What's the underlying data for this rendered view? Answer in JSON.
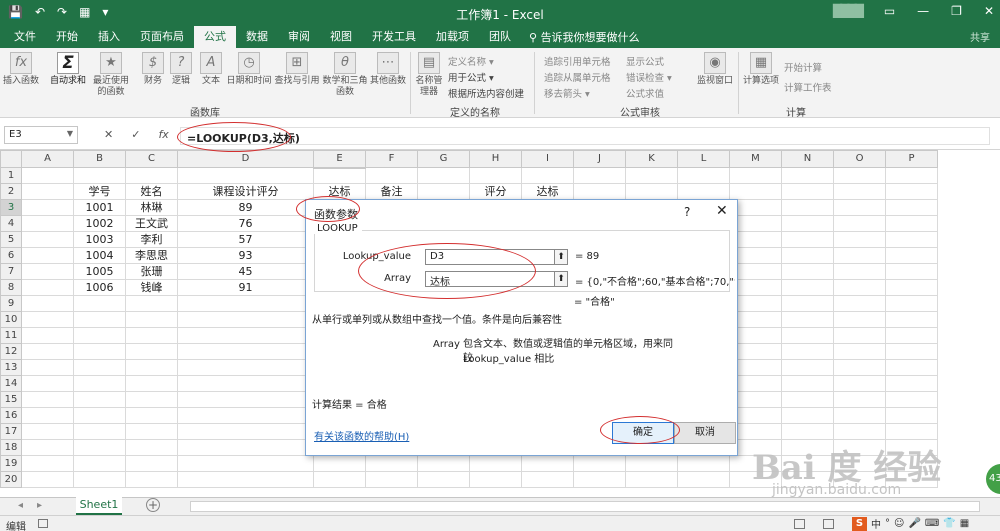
{
  "window": {
    "title": "工作簿1 - Excel",
    "qat": [
      "💾",
      "↶",
      "↷",
      "▦",
      "▾"
    ],
    "controls": [
      "▭",
      "—",
      "❐",
      "✕"
    ],
    "account": "████"
  },
  "tabs": [
    "文件",
    "开始",
    "插入",
    "页面布局",
    "公式",
    "数据",
    "审阅",
    "视图",
    "开发工具",
    "加载项",
    "团队"
  ],
  "tell_me": "告诉我你想要做什么",
  "share": "共享",
  "ribbon": {
    "groups": {
      "function_library": "函数库",
      "defined_names": "定义的名称",
      "formula_auditing": "公式审核",
      "calculation": "计算"
    },
    "buttons": [
      {
        "label": "插入函数",
        "icon": "fx"
      },
      {
        "label": "自动求和",
        "icon": "Σ"
      },
      {
        "label": "最近使用的函数",
        "icon": "★"
      },
      {
        "label": "财务",
        "icon": "$"
      },
      {
        "label": "逻辑",
        "icon": "?"
      },
      {
        "label": "文本",
        "icon": "A"
      },
      {
        "label": "日期和时间",
        "icon": "◷"
      },
      {
        "label": "查找与引用",
        "icon": "⊞"
      },
      {
        "label": "数学和三角函数",
        "icon": "θ"
      },
      {
        "label": "其他函数",
        "icon": "⋯"
      },
      {
        "label": "名称管理器",
        "icon": "▤"
      },
      {
        "label": "监视窗口",
        "icon": "◉"
      },
      {
        "label": "计算选项",
        "icon": "▦"
      }
    ],
    "defined_names": [
      "定义名称 ▾",
      "用于公式 ▾",
      "根据所选内容创建"
    ],
    "auditing_left": [
      "追踪引用单元格",
      "追踪从属单元格",
      "移去箭头 ▾"
    ],
    "auditing_right": [
      "显示公式",
      "错误检查 ▾",
      "公式求值"
    ],
    "calc": [
      "开始计算",
      "计算工作表"
    ]
  },
  "formula_bar": {
    "name_box": "E3",
    "cancel": "✕",
    "enter": "✓",
    "fx": "fx",
    "formula": "=LOOKUP(D3,达标)"
  },
  "columns": [
    "A",
    "B",
    "C",
    "D",
    "E",
    "F",
    "G",
    "H",
    "I",
    "J",
    "K",
    "L",
    "M",
    "N",
    "O",
    "P"
  ],
  "rows": [
    [
      "",
      "",
      "",
      "",
      "",
      "",
      "",
      "",
      "",
      "",
      "",
      "",
      "",
      "",
      "",
      ""
    ],
    [
      "",
      "学号",
      "姓名",
      "课程设计评分",
      "达标",
      "备注",
      "",
      "评分",
      "达标",
      "",
      "",
      "",
      "",
      "",
      "",
      ""
    ],
    [
      "",
      "1001",
      "林琳",
      "89",
      "",
      "",
      "",
      "",
      "",
      "",
      "",
      "",
      "",
      "",
      "",
      ""
    ],
    [
      "",
      "1002",
      "王文武",
      "76",
      "",
      "",
      "",
      "",
      "",
      "",
      "",
      "",
      "",
      "",
      "",
      ""
    ],
    [
      "",
      "1003",
      "李利",
      "57",
      "",
      "",
      "",
      "",
      "",
      "",
      "",
      "",
      "",
      "",
      "",
      ""
    ],
    [
      "",
      "1004",
      "李思思",
      "93",
      "",
      "",
      "",
      "",
      "",
      "",
      "",
      "",
      "",
      "",
      "",
      ""
    ],
    [
      "",
      "1005",
      "张珊",
      "45",
      "",
      "",
      "",
      "",
      "",
      "",
      "",
      "",
      "",
      "",
      "",
      ""
    ],
    [
      "",
      "1006",
      "钱峰",
      "91",
      "",
      "",
      "",
      "",
      "",
      "",
      "",
      "",
      "",
      "",
      "",
      ""
    ],
    [
      "",
      "",
      "",
      "",
      "",
      "",
      "",
      "",
      "",
      "",
      "",
      "",
      "",
      "",
      "",
      ""
    ],
    [
      "",
      "",
      "",
      "",
      "",
      "",
      "",
      "",
      "",
      "",
      "",
      "",
      "",
      "",
      "",
      ""
    ],
    [
      "",
      "",
      "",
      "",
      "",
      "",
      "",
      "",
      "",
      "",
      "",
      "",
      "",
      "",
      "",
      ""
    ],
    [
      "",
      "",
      "",
      "",
      "",
      "",
      "",
      "",
      "",
      "",
      "",
      "",
      "",
      "",
      "",
      ""
    ],
    [
      "",
      "",
      "",
      "",
      "",
      "",
      "",
      "",
      "",
      "",
      "",
      "",
      "",
      "",
      "",
      ""
    ],
    [
      "",
      "",
      "",
      "",
      "",
      "",
      "",
      "",
      "",
      "",
      "",
      "",
      "",
      "",
      "",
      ""
    ],
    [
      "",
      "",
      "",
      "",
      "",
      "",
      "",
      "",
      "",
      "",
      "",
      "",
      "",
      "",
      "",
      ""
    ],
    [
      "",
      "",
      "",
      "",
      "",
      "",
      "",
      "",
      "",
      "",
      "",
      "",
      "",
      "",
      "",
      ""
    ],
    [
      "",
      "",
      "",
      "",
      "",
      "",
      "",
      "",
      "",
      "",
      "",
      "",
      "",
      "",
      "",
      ""
    ],
    [
      "",
      "",
      "",
      "",
      "",
      "",
      "",
      "",
      "",
      "",
      "",
      "",
      "",
      "",
      "",
      ""
    ],
    [
      "",
      "",
      "",
      "",
      "",
      "",
      "",
      "",
      "",
      "",
      "",
      "",
      "",
      "",
      "",
      ""
    ],
    [
      "",
      "",
      "",
      "",
      "",
      "",
      "",
      "",
      "",
      "",
      "",
      "",
      "",
      "",
      "",
      ""
    ]
  ],
  "dialog": {
    "title": "函数参数",
    "help": "?",
    "close": "✕",
    "function": "LOOKUP",
    "args": [
      {
        "label": "Lookup_value",
        "value": "D3",
        "result": "= 89"
      },
      {
        "label": "Array",
        "value": "达标",
        "result": "= {0,\"不合格\";60,\"基本合格\";70,\"合格\";8"
      }
    ],
    "formula_result": "= \"合格\"",
    "description": "从单行或单列或从数组中查找一个值。条件是向后兼容性",
    "arg_name": "Array",
    "arg_desc_line1": "包含文本、数值或逻辑值的单元格区域，用来同 Lookup_value 相比",
    "arg_desc_line2": "较",
    "calc_result": "计算结果 =   合格",
    "help_link": "有关该函数的帮助(H)",
    "ok": "确定",
    "cancel": "取消",
    "ref_icon": "⬆"
  },
  "sheet_tabs": [
    "Sheet1"
  ],
  "add_sheet": "+",
  "sheet_nav": [
    "◂",
    "▸"
  ],
  "status": {
    "mode": "编辑",
    "tray": [
      "中",
      "°",
      "☺",
      "🎤",
      "⌨",
      "👕",
      "▦"
    ],
    "bubble": "43",
    "sogou": "S"
  },
  "watermark": {
    "logo": "Bai 度 经验",
    "url": "jingyan.baidu.com"
  },
  "colors": {
    "excel_green": "#217346",
    "annotation_red": "#d32f2f",
    "link_blue": "#1a5fb4"
  }
}
